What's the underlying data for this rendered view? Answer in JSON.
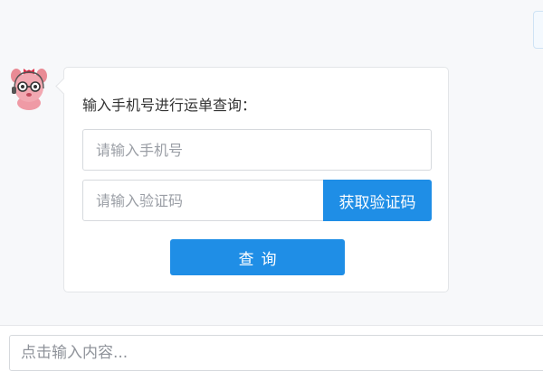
{
  "chat": {
    "prompt": "输入手机号进行运单查询：",
    "phone": {
      "value": "",
      "placeholder": "请输入手机号"
    },
    "code": {
      "value": "",
      "placeholder": "请输入验证码"
    },
    "get_code_label": "获取验证码",
    "query_label": "查询"
  },
  "composer": {
    "value": "",
    "placeholder": "点击输入内容..."
  },
  "theme": {
    "accent": "#1f8ee6",
    "avatar_icon": "pink-cartoon-animal-avatar"
  }
}
